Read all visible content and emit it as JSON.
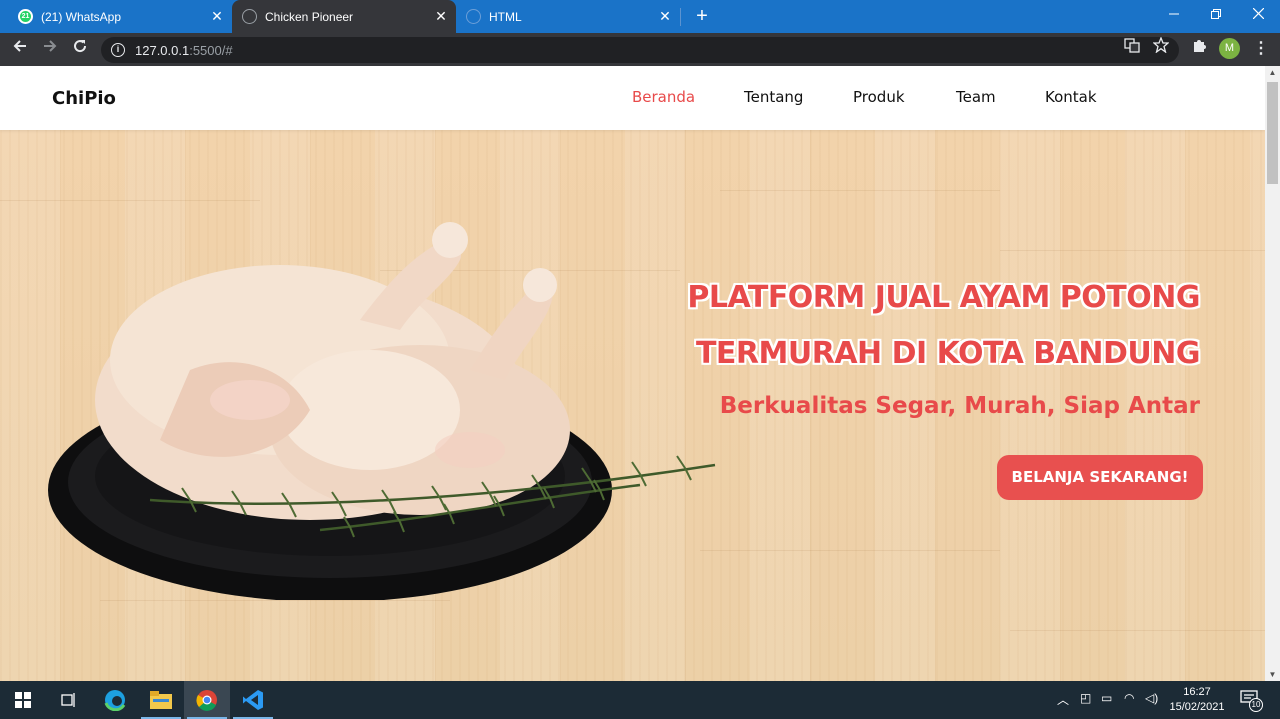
{
  "browser": {
    "tabs": [
      {
        "label": "(21) WhatsApp",
        "badge": "21",
        "icon": "whatsapp-icon"
      },
      {
        "label": "Chicken Pioneer",
        "icon": "globe-icon"
      },
      {
        "label": "HTML",
        "icon": "globe-icon"
      }
    ],
    "close_glyph": "✕",
    "new_tab_glyph": "+",
    "url_host": "127.0.0.1",
    "url_path": ":5500/#",
    "profile_initial": "M"
  },
  "site": {
    "logo": "ChiPio",
    "nav": [
      {
        "label": "Beranda",
        "active": true
      },
      {
        "label": "Tentang",
        "active": false
      },
      {
        "label": "Produk",
        "active": false
      },
      {
        "label": "Team",
        "active": false
      },
      {
        "label": "Kontak",
        "active": false
      }
    ],
    "hero": {
      "title_line1": "PLATFORM JUAL AYAM POTONG",
      "title_line2": "TERMURAH DI KOTA BANDUNG",
      "subtitle": "Berkualitas Segar, Murah, Siap Antar",
      "cta": "BELANJA SEKARANG!"
    },
    "colors": {
      "accent": "#e84a4a",
      "wood": "#f0d2aa"
    }
  },
  "taskbar": {
    "time": "16:27",
    "date": "15/02/2021",
    "notification_count": "10",
    "apps": [
      "windows-start-icon",
      "task-view-icon",
      "edge-icon",
      "file-explorer-icon",
      "chrome-icon",
      "vscode-icon"
    ]
  }
}
